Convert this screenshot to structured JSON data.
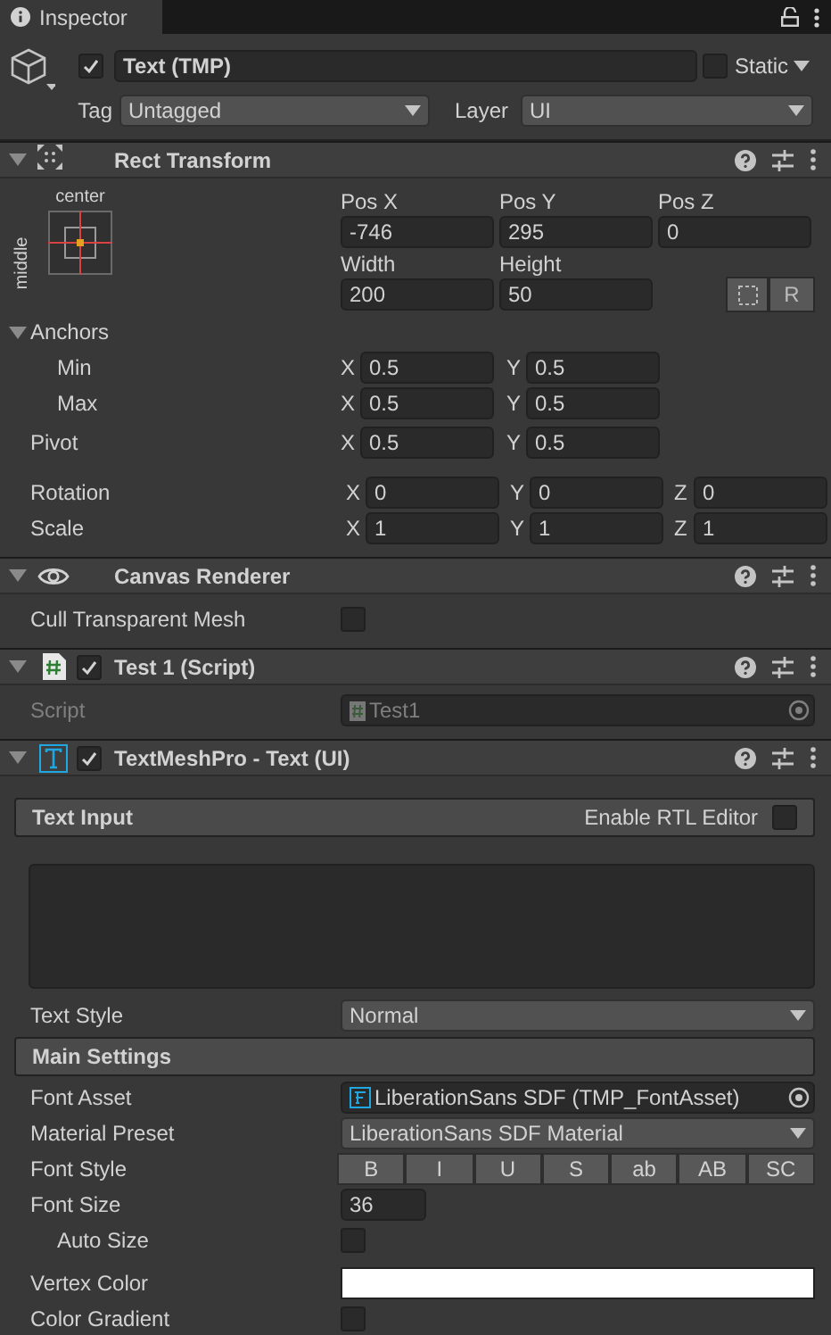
{
  "tab": {
    "title": "Inspector"
  },
  "object": {
    "active": true,
    "name": "Text (TMP)",
    "static": false,
    "static_label": "Static",
    "tag_label": "Tag",
    "tag": "Untagged",
    "layer_label": "Layer",
    "layer": "UI"
  },
  "rect_transform": {
    "title": "Rect Transform",
    "expanded": true,
    "anchor_h": "center",
    "anchor_v": "middle",
    "position": [
      {
        "label": "Pos X",
        "value": "-746"
      },
      {
        "label": "Pos Y",
        "value": "295"
      },
      {
        "label": "Pos Z",
        "value": "0"
      }
    ],
    "size": [
      {
        "label": "Width",
        "value": "200"
      },
      {
        "label": "Height",
        "value": "50"
      }
    ],
    "raw_button": "R",
    "anchors": {
      "label": "Anchors",
      "expanded": true,
      "min": {
        "label": "Min",
        "values": [
          {
            "axis": "X",
            "value": "0.5"
          },
          {
            "axis": "Y",
            "value": "0.5"
          }
        ]
      },
      "max": {
        "label": "Max",
        "values": [
          {
            "axis": "X",
            "value": "0.5"
          },
          {
            "axis": "Y",
            "value": "0.5"
          }
        ]
      }
    },
    "pivot": {
      "label": "Pivot",
      "values": [
        {
          "axis": "X",
          "value": "0.5"
        },
        {
          "axis": "Y",
          "value": "0.5"
        }
      ]
    },
    "rotation": {
      "label": "Rotation",
      "values": [
        {
          "axis": "X",
          "value": "0"
        },
        {
          "axis": "Y",
          "value": "0"
        },
        {
          "axis": "Z",
          "value": "0"
        }
      ]
    },
    "scale": {
      "label": "Scale",
      "values": [
        {
          "axis": "X",
          "value": "1"
        },
        {
          "axis": "Y",
          "value": "1"
        },
        {
          "axis": "Z",
          "value": "1"
        }
      ]
    }
  },
  "components": [
    {
      "kind": "canvas",
      "title": "Canvas Renderer",
      "expanded": true,
      "rows": [
        {
          "kind": "checkbox",
          "label": "Cull Transparent Mesh",
          "checked": false,
          "indented": false
        }
      ]
    },
    {
      "kind": "script",
      "title": "Test 1 (Script)",
      "expanded": true,
      "enabled": true,
      "rows": [
        {
          "kind": "script",
          "label": "Script",
          "value": "Test1",
          "disabled": true
        }
      ]
    },
    {
      "kind": "text",
      "title": "TextMeshPro - Text (UI)",
      "expanded": true,
      "enabled": true,
      "text_input": {
        "title": "Text Input",
        "rtl_label": "Enable RTL Editor",
        "rtl": false
      },
      "rows": [
        {
          "kind": "dropdown",
          "label": "Text Style",
          "value": "Normal"
        },
        {
          "kind": "section",
          "label": "Main Settings"
        },
        {
          "kind": "asset",
          "label": "Font Asset",
          "value": "LiberationSans SDF (TMP_FontAsset)",
          "disabled": false
        },
        {
          "kind": "dropdown",
          "label": "Material Preset",
          "value": "LiberationSans SDF Material"
        },
        {
          "kind": "buttons",
          "label": "Font Style",
          "buttons": [
            {
              "label": "B",
              "selected": false
            },
            {
              "label": "I",
              "selected": false
            },
            {
              "label": "U",
              "selected": false
            },
            {
              "label": "S",
              "selected": false
            },
            {
              "label": "ab",
              "selected": false
            },
            {
              "label": "AB",
              "selected": false
            },
            {
              "label": "SC",
              "selected": false
            }
          ]
        },
        {
          "kind": "number",
          "label": "Font Size",
          "value": "36"
        },
        {
          "kind": "checkbox",
          "label": "Auto Size",
          "checked": false,
          "indented": true
        },
        {
          "kind": "color",
          "label": "Vertex Color",
          "color": "#ffffff"
        },
        {
          "kind": "checkbox",
          "label": "Color Gradient",
          "checked": false,
          "indented": false
        }
      ]
    }
  ]
}
